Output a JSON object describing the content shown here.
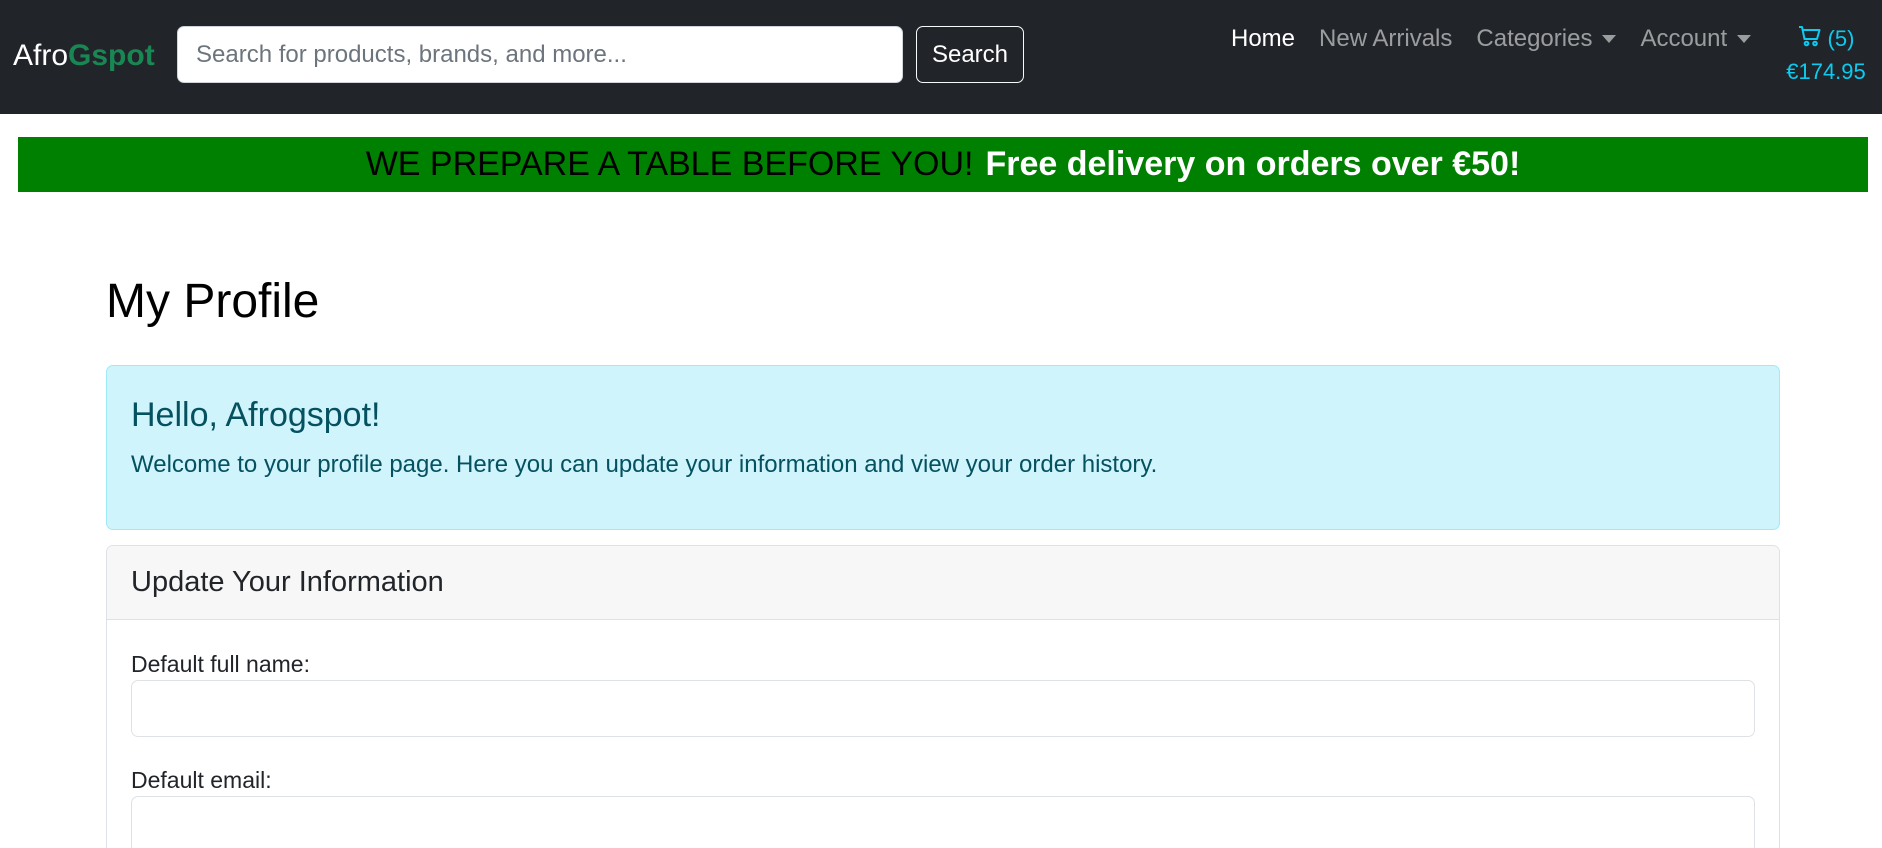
{
  "navbar": {
    "brand_part1": "Afro",
    "brand_part2": "Gspot",
    "search_placeholder": "Search for products, brands, and more...",
    "search_button": "Search",
    "links": {
      "home": "Home",
      "new_arrivals": "New Arrivals",
      "categories": "Categories",
      "account": "Account"
    },
    "cart_count": "(5)",
    "cart_total": "€174.95"
  },
  "banner": {
    "part1": "WE PREPARE A TABLE BEFORE YOU!",
    "part2": "Free delivery on orders over €50!"
  },
  "main": {
    "title": "My Profile",
    "alert": {
      "heading": "Hello, Afrogspot!",
      "text": "Welcome to your profile page. Here you can update your information and view your order history."
    },
    "form": {
      "header": "Update Your Information",
      "full_name_label": "Default full name:",
      "full_name_value": "",
      "email_label": "Default email:",
      "email_value": ""
    }
  },
  "colors": {
    "navbar_bg": "#212529",
    "brand_accent": "#198754",
    "banner_bg": "#008000",
    "cart_color": "#0dcaf0",
    "alert_bg": "#cff4fc",
    "alert_text": "#055160"
  }
}
